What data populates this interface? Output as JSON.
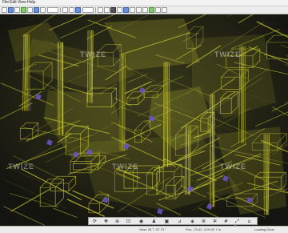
{
  "menubar": {
    "items": [
      "File",
      "Edit",
      "View",
      "Help"
    ]
  },
  "viewport": {
    "watermark": "TWIZE",
    "render_color": "#c8c832",
    "marker_color": "#6b55c8"
  },
  "navbar": {
    "buttons": [
      {
        "icon": "orbit-icon",
        "glyph": "⟳"
      },
      {
        "icon": "pan-icon",
        "glyph": "✥"
      },
      {
        "icon": "zoom-icon",
        "glyph": "⊕"
      },
      {
        "icon": "fit-icon",
        "glyph": "⊡"
      },
      {
        "icon": "eye-icon",
        "glyph": "◉"
      },
      {
        "icon": "walk-icon",
        "glyph": "♟"
      },
      {
        "icon": "camera-icon",
        "glyph": "▣"
      },
      {
        "icon": "measure-icon",
        "glyph": "⊿"
      },
      {
        "icon": "section-icon",
        "glyph": "◈"
      },
      {
        "icon": "layers-icon",
        "glyph": "≣"
      },
      {
        "icon": "settings-icon",
        "glyph": "✲"
      },
      {
        "icon": "grid-icon",
        "glyph": "#"
      },
      {
        "icon": "expand-icon",
        "glyph": "⤢"
      },
      {
        "icon": "home-icon",
        "glyph": "⌂"
      }
    ]
  },
  "statusbar": {
    "view": "View: 25.7 -57.75 °",
    "position": "Pos: -73.42 -3.09 42.7 m",
    "status": "Loading Done"
  }
}
